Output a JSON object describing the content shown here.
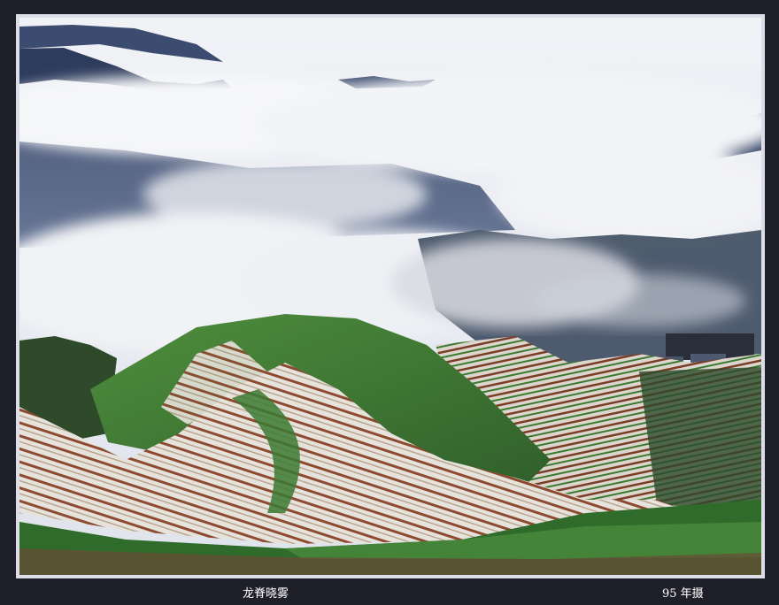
{
  "photo": {
    "subject": "mist-over-rice-terraces",
    "palette": {
      "sky": "#eef0f4",
      "mountain": "#2e3f63",
      "cloud": "#f2f3f6",
      "terrace_green": "#3f8a3a",
      "terrace_brown": "#8b4a2f",
      "terrace_water": "#e4e2dc",
      "frame_background": "#1f1f2a"
    }
  },
  "captions": {
    "title": "龙脊晓雾",
    "year": "95 年摄"
  }
}
